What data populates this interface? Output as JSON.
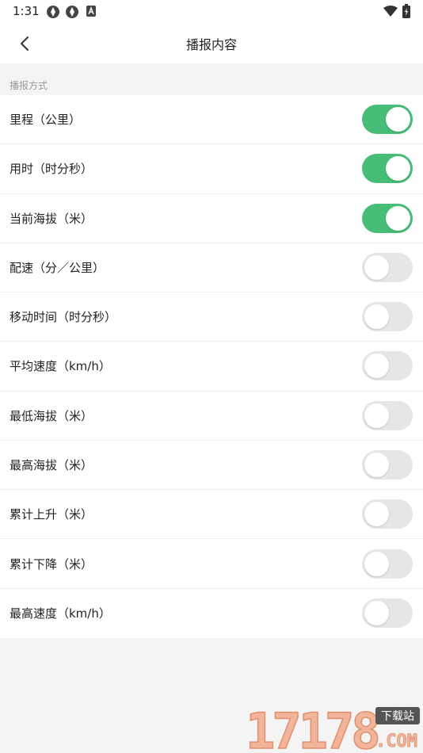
{
  "status_bar": {
    "time": "1:31"
  },
  "header": {
    "title": "播报内容"
  },
  "section": {
    "label": "播报方式"
  },
  "items": [
    {
      "label": "里程（公里）",
      "enabled": true
    },
    {
      "label": "用时（时分秒）",
      "enabled": true
    },
    {
      "label": "当前海拔（米）",
      "enabled": true
    },
    {
      "label": "配速（分／公里）",
      "enabled": false
    },
    {
      "label": "移动时间（时分秒）",
      "enabled": false
    },
    {
      "label": "平均速度（km/h）",
      "enabled": false
    },
    {
      "label": "最低海拔（米）",
      "enabled": false
    },
    {
      "label": "最高海拔（米）",
      "enabled": false
    },
    {
      "label": "累计上升（米）",
      "enabled": false
    },
    {
      "label": "累计下降（米）",
      "enabled": false
    },
    {
      "label": "最高速度（km/h）",
      "enabled": false
    }
  ],
  "watermark": {
    "number": "17178",
    "tag": "下载站",
    "domain": ".COM"
  },
  "colors": {
    "toggle_on": "#47bd77",
    "toggle_off": "#e6e6e6"
  }
}
